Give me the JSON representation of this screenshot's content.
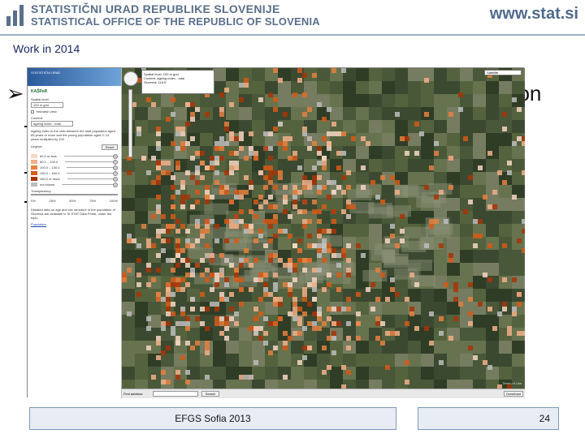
{
  "header": {
    "org_line1": "STATISTIČNI URAD REPUBLIKE SLOVENIJE",
    "org_line2": "STATISTICAL OFFICE OF THE REPUBLIC OF SLOVENIA",
    "url": "www.stat.si",
    "logo_icon": "stat-office-logo-icon"
  },
  "slide": {
    "section": "Work in 2014",
    "bullet_text_visible": "ation"
  },
  "screenshot": {
    "panel": {
      "brand": "KAŠPeR",
      "field1_label": "Spatial level:",
      "field1_value": "100 m grid",
      "checkbox_label": "Yellowish view",
      "field2_label": "Content:",
      "field2_value": "ageing index - total",
      "description": "Ageing index is the ratio between the total population aged 65 years or more and the young population aged 0–14 years multiplied by 100",
      "legend_label": "Legend:",
      "reset_label": "Reset",
      "legend_items": [
        {
          "label": "60.0 or less",
          "color": "#f7d7c4"
        },
        {
          "label": "60.1 – 100.0",
          "color": "#f2b08a"
        },
        {
          "label": "100.0 – 130.0",
          "color": "#e6803f"
        },
        {
          "label": "130.0 – 160.0",
          "color": "#d55a18"
        },
        {
          "label": "160.0 or more",
          "color": "#a83408"
        },
        {
          "label": "not shown",
          "color": "#bdbdbd"
        }
      ],
      "transparency_label": "Transparency:",
      "transparency_ticks": [
        "0%",
        "25%",
        "50%",
        "75%",
        "100%"
      ],
      "footer_text": "Detailed data on age and sex structure of the population of Slovenia are available in SI-STAT Data Portal, under the topic",
      "footer_link": "Population"
    },
    "map": {
      "info_line1": "Spatial level: 100 m grid",
      "info_line2": "Content: ageing index - total",
      "info_line3": "Slovenia: 118.5",
      "layer_select": "Satellite",
      "search_label": "Find address:",
      "search_button": "Search",
      "download_button": "Download",
      "terms": "Terms of Use"
    }
  },
  "footer": {
    "event": "EFGS Sofia 2013",
    "page": "24"
  },
  "colors": {
    "header_text": "#5a6f8c",
    "section_text": "#1a2a66",
    "footer_bg": "#e8ecf4",
    "footer_border": "#7f97bf"
  }
}
